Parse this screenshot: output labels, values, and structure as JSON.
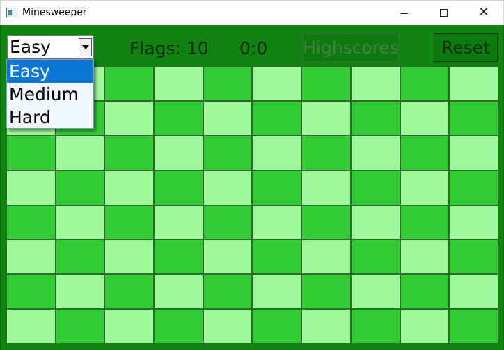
{
  "window": {
    "title": "Minesweeper",
    "app_icon": "window-icon",
    "controls": [
      "minimize-icon",
      "maximize-icon",
      "close-icon"
    ]
  },
  "toolbar": {
    "difficulty_value": "Easy",
    "flags_text": "Flags: 10",
    "timer_text": "0:0",
    "highscores_label": "Highscores",
    "reset_label": "Reset"
  },
  "dropdown": {
    "options": [
      "Easy",
      "Medium",
      "Hard"
    ],
    "selected_index": 0
  },
  "board": {
    "columns": 10,
    "rows": 8
  },
  "colors": {
    "background": "#0f820f",
    "cell_light": "#9ef89a",
    "cell_dark": "#33cb33",
    "selection": "#0b78d8",
    "highscores_disabled_text": "#4b7d4b"
  }
}
